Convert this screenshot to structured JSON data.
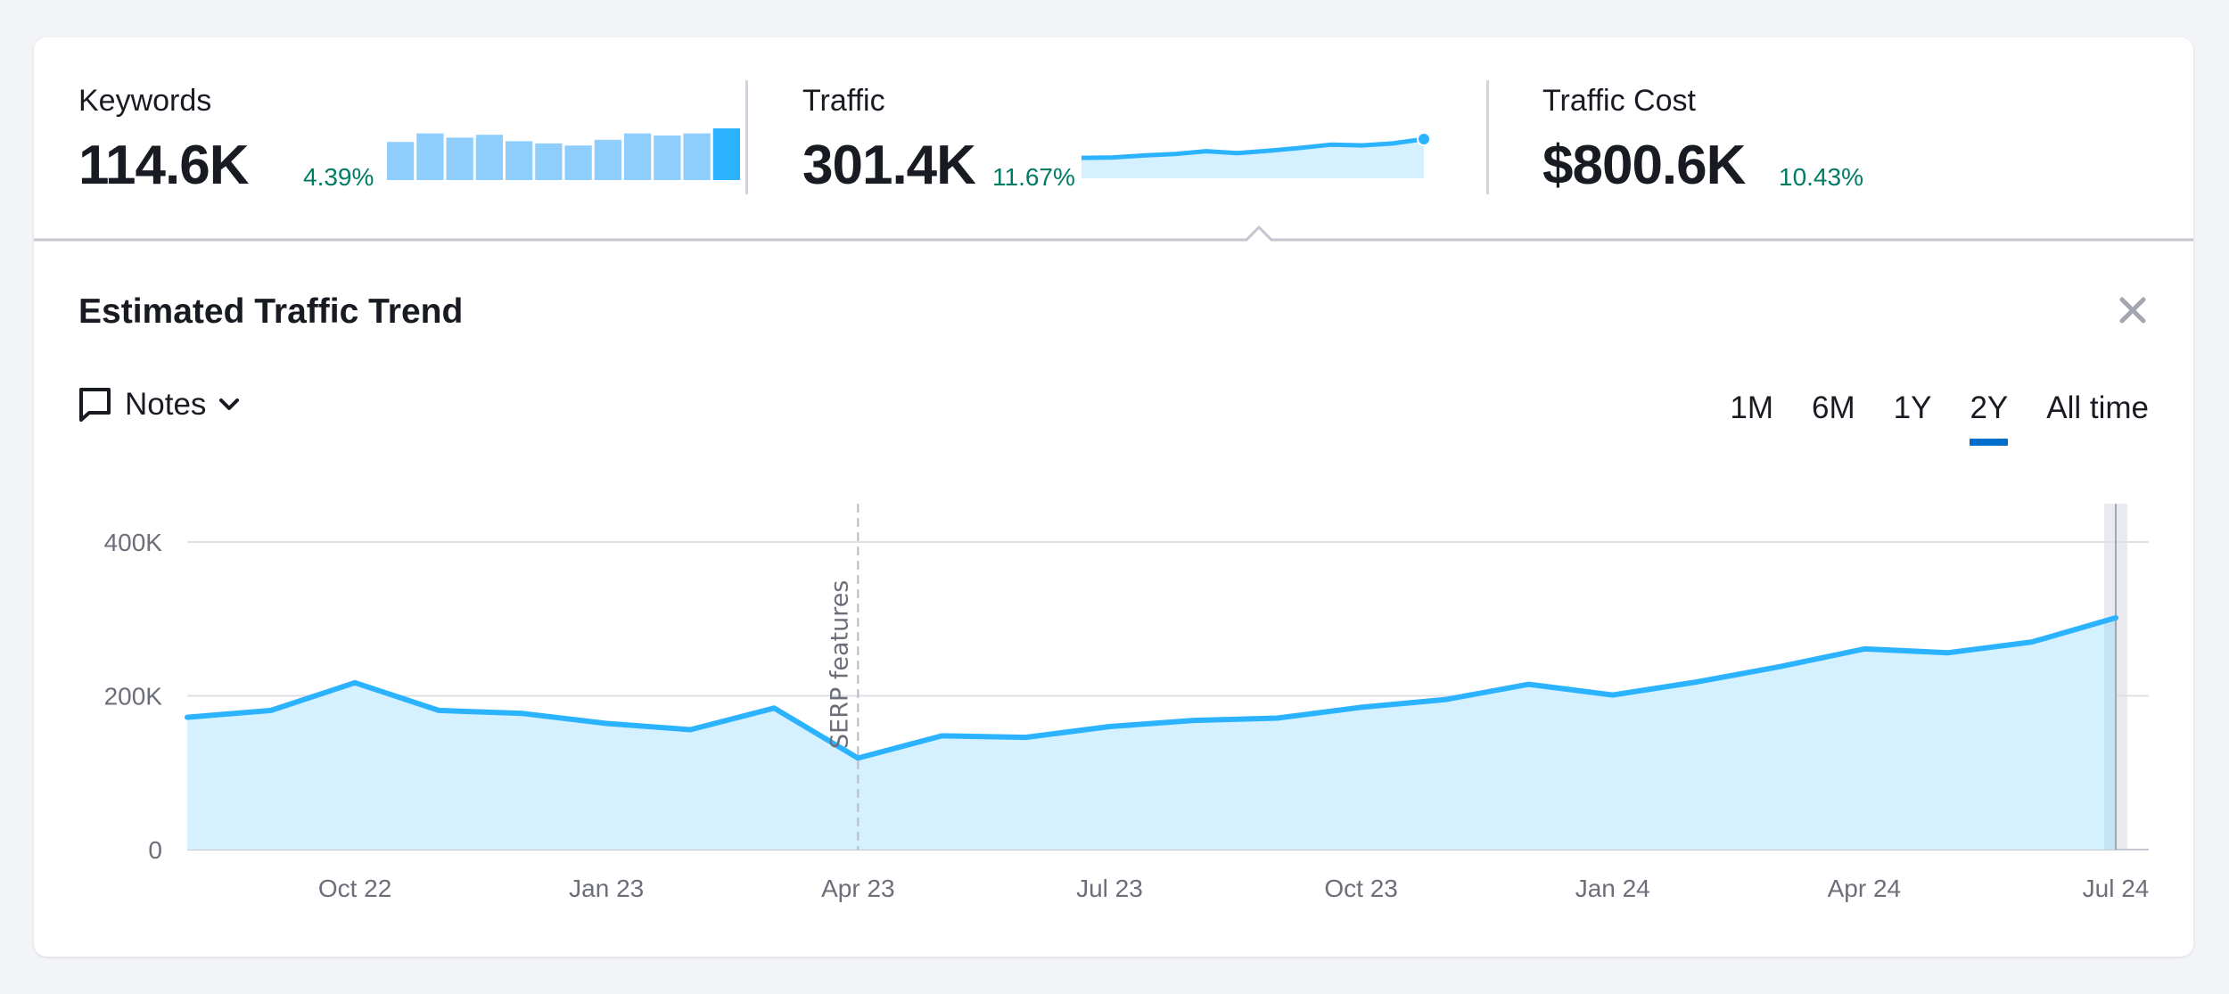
{
  "metrics": [
    {
      "label": "Keywords",
      "value": "114.6K",
      "change": "4.39%",
      "sparkline_type": "bar",
      "sparkline_values": [
        99.8,
        109.1,
        104.5,
        107.6,
        100.6,
        98.2,
        95.9,
        102.1,
        109.1,
        106.8,
        109.1,
        114.6
      ]
    },
    {
      "label": "Traffic",
      "value": "301.4K",
      "change": "11.67%",
      "sparkline_type": "area",
      "sparkline_values": [
        168,
        171,
        185,
        195,
        215,
        201,
        218,
        238,
        261,
        256,
        270,
        301
      ]
    },
    {
      "label": "Traffic Cost",
      "value": "$800.6K",
      "change": "10.43%"
    }
  ],
  "colors": {
    "accent": "#2bb3ff",
    "area_fill": "#d5f0ff",
    "bar": "#8fcdfd",
    "bar_active": "#2bb3ff",
    "positive": "#007c65",
    "tab_underline": "#006dca",
    "background": "#f3f4f8"
  },
  "panel": {
    "title": "Estimated Traffic Trend",
    "close_icon": "close-icon",
    "notes_label": "Notes",
    "notes_icon": "comment-icon",
    "periods": [
      "1M",
      "6M",
      "1Y",
      "2Y",
      "All time"
    ],
    "active_period": "2Y"
  },
  "chart_data": {
    "type": "area",
    "title": "Estimated Traffic Trend",
    "xlabel": "",
    "ylabel": "",
    "x": [
      "Aug 22",
      "Sep 22",
      "Oct 22",
      "Nov 22",
      "Dec 22",
      "Jan 23",
      "Feb 23",
      "Mar 23",
      "Apr 23",
      "May 23",
      "Jun 23",
      "Jul 23",
      "Aug 23",
      "Sep 23",
      "Oct 23",
      "Nov 23",
      "Dec 23",
      "Jan 24",
      "Feb 24",
      "Mar 24",
      "Apr 24",
      "May 24",
      "Jun 24",
      "Jul 24"
    ],
    "series": [
      {
        "name": "Traffic",
        "values": [
          172000,
          181000,
          217000,
          181000,
          177000,
          164000,
          156000,
          184000,
          119000,
          148000,
          146000,
          160000,
          168000,
          171000,
          185000,
          195000,
          215000,
          201000,
          218000,
          238000,
          261000,
          256000,
          270000,
          301400
        ]
      }
    ],
    "x_tick_labels": [
      "Oct 22",
      "Jan 23",
      "Apr 23",
      "Jul 23",
      "Oct 23",
      "Jan 24",
      "Apr 24",
      "Jul 24"
    ],
    "x_tick_indices": [
      2,
      5,
      8,
      11,
      14,
      17,
      20,
      23
    ],
    "y_tick_labels": [
      "0",
      "200K",
      "400K"
    ],
    "y_ticks": [
      0,
      200000,
      400000
    ],
    "ylim": [
      0,
      400000
    ],
    "grid": true,
    "annotations": [
      {
        "label": "SERP features",
        "x": "Apr 23",
        "style": "dashed-vertical-line"
      }
    ],
    "highlight_x": "Jul 24"
  }
}
